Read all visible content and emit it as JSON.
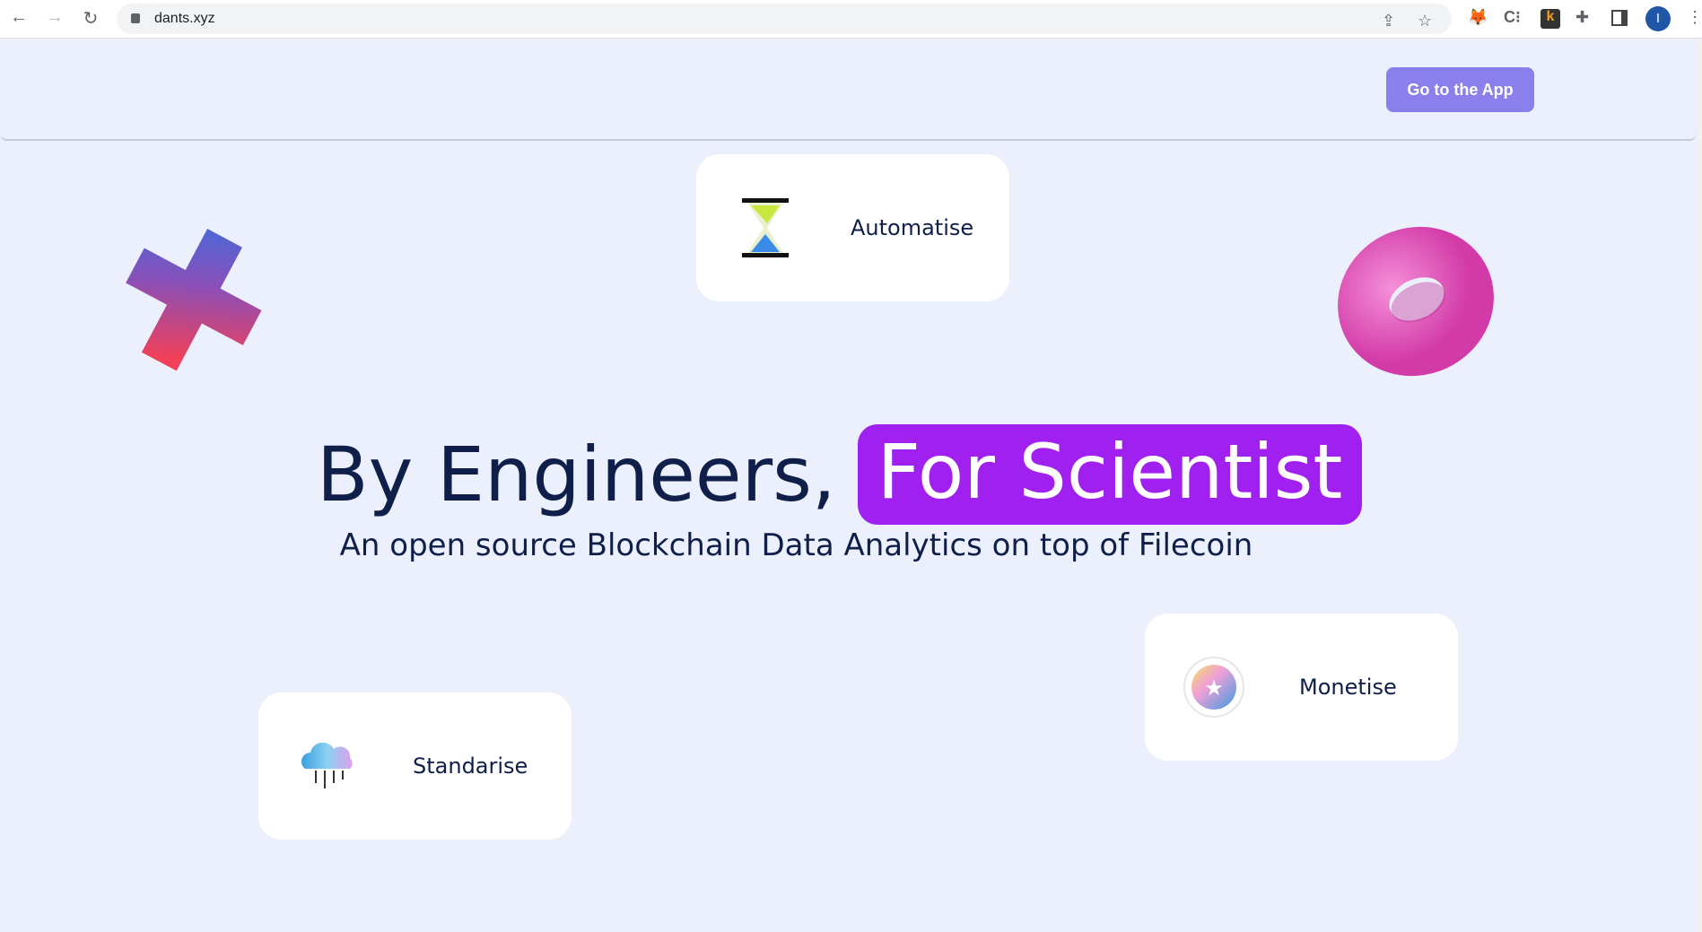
{
  "browser": {
    "url": "dants.xyz",
    "avatar_letter": "I"
  },
  "header": {
    "cta_label": "Go to the App",
    "cta_color": "#8b7fec"
  },
  "hero": {
    "title_part1": "By Engineers,",
    "title_highlight": "For Scientist",
    "highlight_color": "#a020f0",
    "subtitle": "An open source Blockchain Data Analytics on top of Filecoin"
  },
  "cards": [
    {
      "label": "Automatise",
      "icon": "hourglass-icon"
    },
    {
      "label": "Monetise",
      "icon": "star-coin-icon"
    },
    {
      "label": "Standarise",
      "icon": "cloud-icon"
    }
  ]
}
